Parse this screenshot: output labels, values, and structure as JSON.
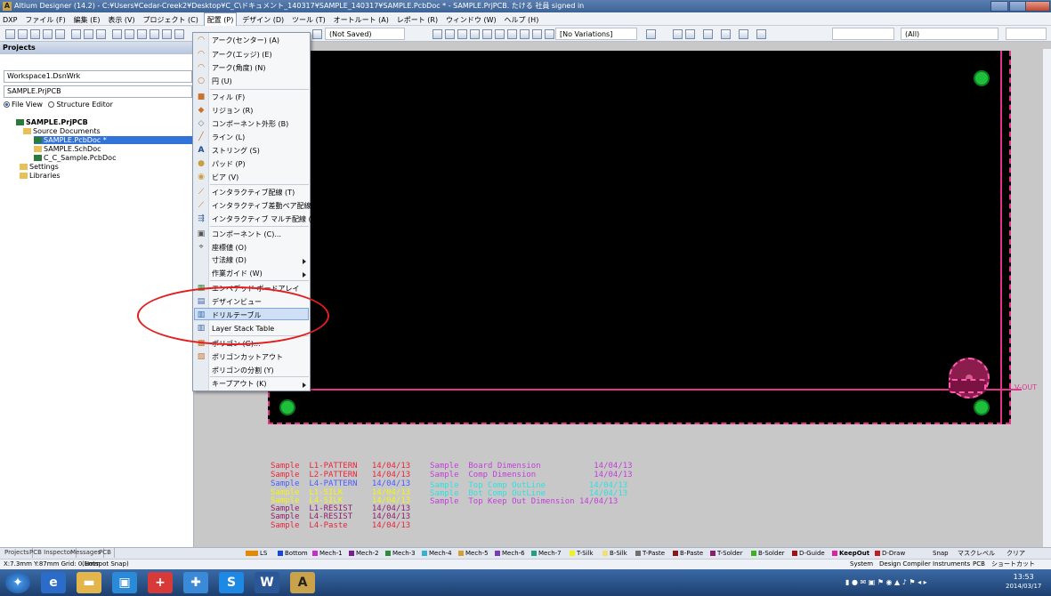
{
  "window": {
    "title": "Altium Designer (14.2) - C:¥Users¥Cedar-Creek2¥Desktop¥C_C\\ドキュメント_140317¥SAMPLE_140317¥SAMPLE.PcbDoc * - SAMPLE.PrjPCB. たける 社員 signed in"
  },
  "menubar": {
    "items": [
      "DXP",
      "ファイル (F)",
      "編集 (E)",
      "表示 (V)",
      "プロジェクト (C)",
      "配置 (P)",
      "デザイン (D)",
      "ツール (T)",
      "オートルート (A)",
      "レポート (R)",
      "ウィンドウ (W)",
      "ヘルプ (H)"
    ]
  },
  "toolbar": {
    "saved_state": "(Not Saved)",
    "variations": "[No Variations]",
    "filter": "(All)"
  },
  "panel": {
    "title": "Projects",
    "workspace": "Workspace1.DsnWrk",
    "project_field": "SAMPLE.PrjPCB",
    "view_file": "File View",
    "view_structure": "Structure Editor",
    "tree": [
      "SAMPLE.PrjPCB",
      "Source Documents",
      "SAMPLE.PcbDoc *",
      "SAMPLE.SchDoc",
      "C_C_Sample.PcbDoc",
      "Settings",
      "Libraries"
    ]
  },
  "context_menu": {
    "items": [
      "アーク(センター) (A)",
      "アーク(エッジ) (E)",
      "アーク(角度) (N)",
      "円 (U)",
      "フィル (F)",
      "リジョン (R)",
      "コンポーネント外形 (B)",
      "ライン (L)",
      "ストリング (S)",
      "パッド (P)",
      "ビア (V)",
      "インタラクティブ配線 (T)",
      "インタラクティブ差動ペア配線 (I)",
      "インタラクティブ マルチ配線 (M)",
      "コンポーネント (C)...",
      "座標値 (O)",
      "寸法線 (D)",
      "作業ガイド (W)",
      "エンベデッド ボードアレイ",
      "デザインビュー",
      "ドリルテーブル",
      "Layer Stack Table",
      "ポリゴン (G)...",
      "ポリゴンカットアウト",
      "ポリゴンの分割 (Y)",
      "キープアウト (K)"
    ],
    "highlighted": "ドリルテーブル"
  },
  "board_text": {
    "block1": [
      {
        "a": "Sample",
        "b": "L1-PATTERN",
        "c": "14/04/13",
        "color": "#e8263c"
      },
      {
        "a": "Sample",
        "b": "L2-PATTERN",
        "c": "14/04/13",
        "color": "#e8263c"
      },
      {
        "a": "Sample",
        "b": "L4-PATTERN",
        "c": "14/04/13",
        "color": "#4a5cff"
      },
      {
        "a": "Sample",
        "b": "L1-SILK",
        "c": "14/04/13",
        "color": "#f4f411"
      },
      {
        "a": "Sample",
        "b": "L4-SILK",
        "c": "14/04/13",
        "color": "#f4f411"
      },
      {
        "a": "Sample",
        "b": "L1-RESIST",
        "c": "14/04/13",
        "color": "#8e1f6b"
      },
      {
        "a": "Sample",
        "b": "L4-RESIST",
        "c": "14/04/13",
        "color": "#8e1f6b"
      },
      {
        "a": "Sample",
        "b": "L4-Paste",
        "c": "14/04/13",
        "color": "#e8263c"
      }
    ],
    "block2": [
      {
        "a": "Sample",
        "b": "Board Dimension",
        "c": "14/04/13",
        "color": "#c13fd8"
      },
      {
        "a": "Sample",
        "b": "Comp Dimension",
        "c": "14/04/13",
        "color": "#c13fd8"
      },
      {
        "a": "Sample",
        "b": "Top Comp OutLine",
        "c": "14/04/13",
        "color": "#2fe0e0"
      },
      {
        "a": "Sample",
        "b": "Bot Comp OutLine",
        "c": "14/04/13",
        "color": "#2fe0e0"
      },
      {
        "a": "Sample",
        "b": "Top Keep Out Dimension",
        "c": "14/04/13",
        "color": "#c13fd8"
      }
    ],
    "ko_label": "V-OUT"
  },
  "bottom_tabs": [
    "Projects",
    "PCB Inspector",
    "Messages",
    "PCB"
  ],
  "layer_tabs": [
    {
      "label": "LS",
      "color": "#e58a00"
    },
    {
      "label": "Bottom",
      "color": "#1747d8"
    },
    {
      "label": "Mech-1",
      "color": "#cc2bcc"
    },
    {
      "label": "Mech-2",
      "color": "#7a1f90"
    },
    {
      "label": "Mech-3",
      "color": "#2b8c3a"
    },
    {
      "label": "Mech-4",
      "color": "#3ab0d0"
    },
    {
      "label": "Mech-5",
      "color": "#d4a030"
    },
    {
      "label": "Mech-6",
      "color": "#7c3ab8"
    },
    {
      "label": "Mech-7",
      "color": "#20a080"
    },
    {
      "label": "T-Silk",
      "color": "#f0f020"
    },
    {
      "label": "B-Silk",
      "color": "#f0e070"
    },
    {
      "label": "T-Paste",
      "color": "#707070"
    },
    {
      "label": "B-Paste",
      "color": "#8a1818"
    },
    {
      "label": "T-Solder",
      "color": "#8a2070"
    },
    {
      "label": "B-Solder",
      "color": "#40b020"
    },
    {
      "label": "D-Guide",
      "color": "#a01010"
    },
    {
      "label": "KeepOut",
      "color": "#e020a0"
    },
    {
      "label": "D-Draw",
      "color": "#c02020"
    }
  ],
  "bottom_right": [
    "Snap",
    "マスクレベル",
    "クリア"
  ],
  "status": {
    "coords": "X:7.3mm Y:87mm   Grid: 0.1mm",
    "snap": "(Hotspot Snap)",
    "panels": [
      "System",
      "Design Compiler",
      "Instruments",
      "PCB",
      "ショートカット"
    ]
  },
  "clock": {
    "time": "13:53",
    "date": "2014/03/17"
  }
}
